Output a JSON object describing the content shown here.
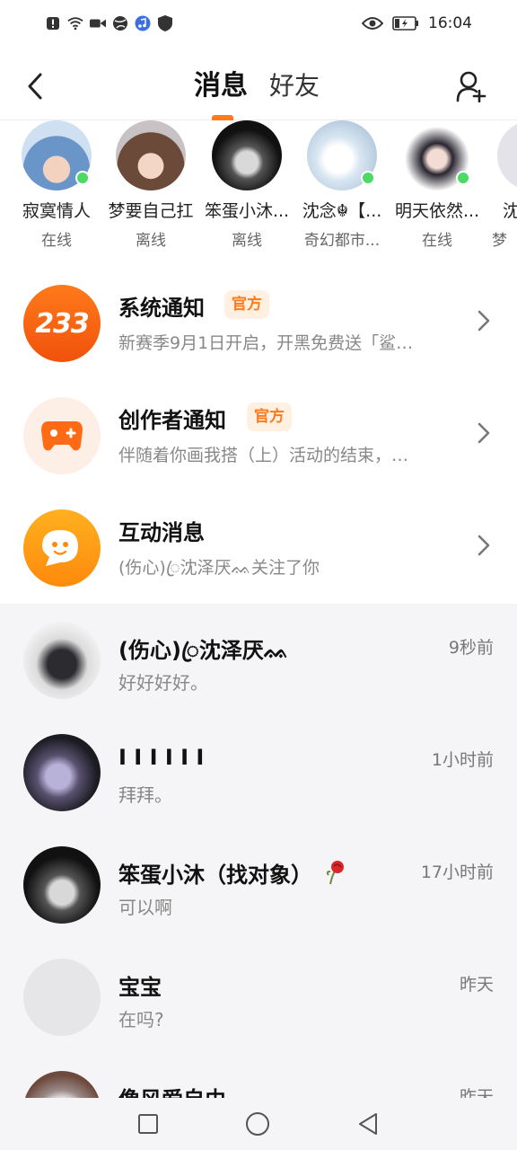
{
  "status_bar": {
    "time": "16:04",
    "left_icons": [
      "alert-icon",
      "wifi-icon",
      "video-icon",
      "globe-icon",
      "music-icon",
      "shield-icon"
    ],
    "right_icons": [
      "eye-icon",
      "battery-icon"
    ]
  },
  "header": {
    "tabs": [
      {
        "label": "消息",
        "active": true
      },
      {
        "label": "好友",
        "active": false
      }
    ],
    "accent_color": "#ff7a1a"
  },
  "friends": [
    {
      "name": "寂寞情人",
      "status": "在线",
      "online": true
    },
    {
      "name": "梦要自己扛",
      "status": "离线",
      "online": false
    },
    {
      "name": "笨蛋小沐...",
      "status": "离线",
      "online": false
    },
    {
      "name": "沈念☬【...",
      "status": "奇幻都市...",
      "online": true
    },
    {
      "name": "明天依然...",
      "status": "在线",
      "online": true
    },
    {
      "name": "沈",
      "status": "梦",
      "online": false
    }
  ],
  "notices": [
    {
      "title": "系统通知",
      "badge": "官方",
      "subtitle": "新赛季9月1日开启，开黑免费送「鲨…",
      "icon": "233-logo-icon",
      "icon_text": "233"
    },
    {
      "title": "创作者通知",
      "badge": "官方",
      "subtitle": "伴随着你画我搭（上）活动的结束，…",
      "icon": "gamepad-icon"
    },
    {
      "title": "互动消息",
      "badge": "",
      "subtitle": "(伤心)ꦿ沈泽厌ᨐ关注了你",
      "icon": "chat-bubble-icon"
    }
  ],
  "chats": [
    {
      "name": "(伤心)ꦿ沈泽厌ᨐ",
      "time": "9秒前",
      "message": "好好好好。"
    },
    {
      "name": "I I I I I I",
      "time": "1小时前",
      "message": "拜拜。"
    },
    {
      "name": "笨蛋小沐（找对象）",
      "time": "17小时前",
      "message": "可以啊"
    },
    {
      "name": "宝宝",
      "time": "昨天",
      "message": "在吗?"
    },
    {
      "name": "像风爱自由",
      "time": "昨天",
      "message": ""
    }
  ],
  "nav_bar": {
    "buttons": [
      "recent-apps-icon",
      "home-icon",
      "back-triangle-icon"
    ]
  }
}
